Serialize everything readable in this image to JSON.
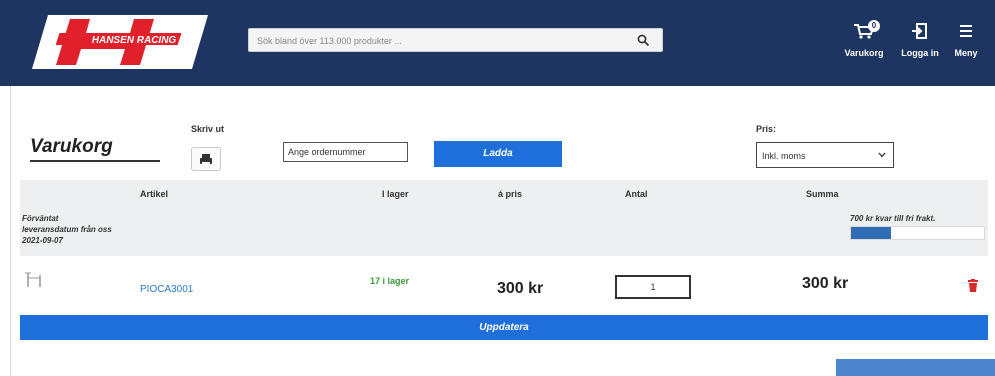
{
  "header": {
    "logo_text": "HANSEN RACING",
    "search": {
      "placeholder": "Sök bland över 113.000 produkter ...",
      "value": ""
    },
    "cart": {
      "label": "Varukorg",
      "badge": "0"
    },
    "login": {
      "label": "Logga in"
    },
    "menu": {
      "label": "Meny"
    }
  },
  "toolbar": {
    "title": "Varukorg",
    "print_label": "Skriv ut",
    "order_input_placeholder": "Ange ordernummer",
    "load_label": "Ladda",
    "price_label": "Pris:",
    "price_selected": "Inkl. moms"
  },
  "table": {
    "headers": {
      "article": "Artikel",
      "stock": "I lager",
      "unit_price": "á pris",
      "quantity": "Antal",
      "sum": "Summa"
    },
    "delivery_lines": [
      "Förväntat",
      "leveransdatum från oss",
      "2021-09-07"
    ],
    "freight_text": "700 kr kvar till fri frakt.",
    "freight_progress": 0.3,
    "rows": [
      {
        "sku": "PIOCA3001",
        "stock": "17 i lager",
        "unit_price": "300 kr",
        "quantity": "1",
        "sum": "300 kr"
      }
    ]
  },
  "actions": {
    "update_label": "Uppdatera"
  },
  "colors": {
    "header_bg": "#1f3561",
    "primary_button": "#1e6fd9",
    "link": "#2a7ad6",
    "stock_green": "#3a9a3a",
    "trash_red": "#d92b2b",
    "logo_red": "#e0202a"
  }
}
